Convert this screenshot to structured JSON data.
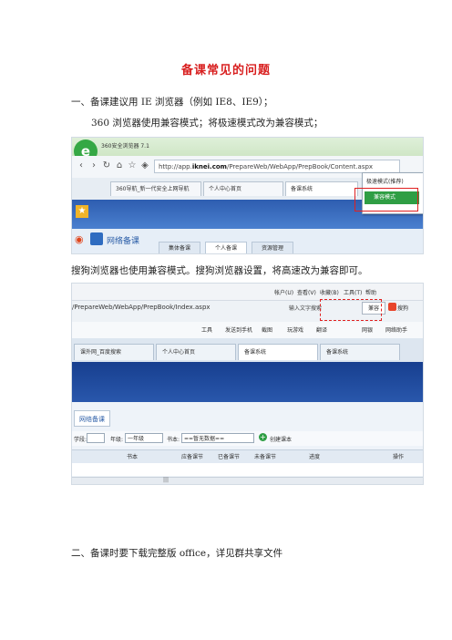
{
  "doc": {
    "title": "备课常见的问题",
    "section1": "一、备课建议用 IE 浏览器（例如 IE8、IE9）；",
    "para1": "360 浏览器使用兼容模式；将极速模式改为兼容模式；",
    "para2": "搜狗浏览器也使用兼容模式。搜狗浏览器设置，将高速改为兼容即可。",
    "section2": "二、备课时要下载完整版 office，详见群共享文件"
  },
  "shot1": {
    "window_title": "360安全浏览器 7.1",
    "url_prefix": "http://app.",
    "url_domain": "iknei.com",
    "url_path": "/PrepareWeb/WebApp/PrepBook/Content.aspx",
    "tabs": [
      "360导航_新一代安全上网导航",
      "个人中心首页",
      "备课系统"
    ],
    "menu_top": "极速模式(推荐)",
    "menu_selected": "兼容模式",
    "app_name": "网络备课",
    "app_tabs": [
      "集体备课",
      "个人备课",
      "资源管理"
    ]
  },
  "shot2": {
    "menu": [
      "帐户(U)",
      "查看(V)",
      "收藏(B)",
      "工具(T)",
      "帮助"
    ],
    "url": "/PrepareWeb/WebApp/PrepBook/Index.aspx",
    "search_label": "输入文字搜索",
    "mode_label": "兼容",
    "search_engine": "搜狗",
    "bookmarks": [
      "工具",
      "发送到手机",
      "截图",
      "玩游戏",
      "翻译",
      "网银",
      "网络助手"
    ],
    "tabs": [
      "课外网_百度搜索",
      "个人中心首页",
      "备课系统",
      "备课系统"
    ],
    "nav_tab": "网络备课",
    "filter": {
      "label1": "学段:",
      "label2": "年级:",
      "grade_value": "一年级",
      "label3": "书本:",
      "book_value": "==暂无数据==",
      "add_label": "创建课本"
    },
    "columns": [
      "书本",
      "应备课节",
      "已备课节",
      "未备课节",
      "进度",
      "操作"
    ]
  }
}
